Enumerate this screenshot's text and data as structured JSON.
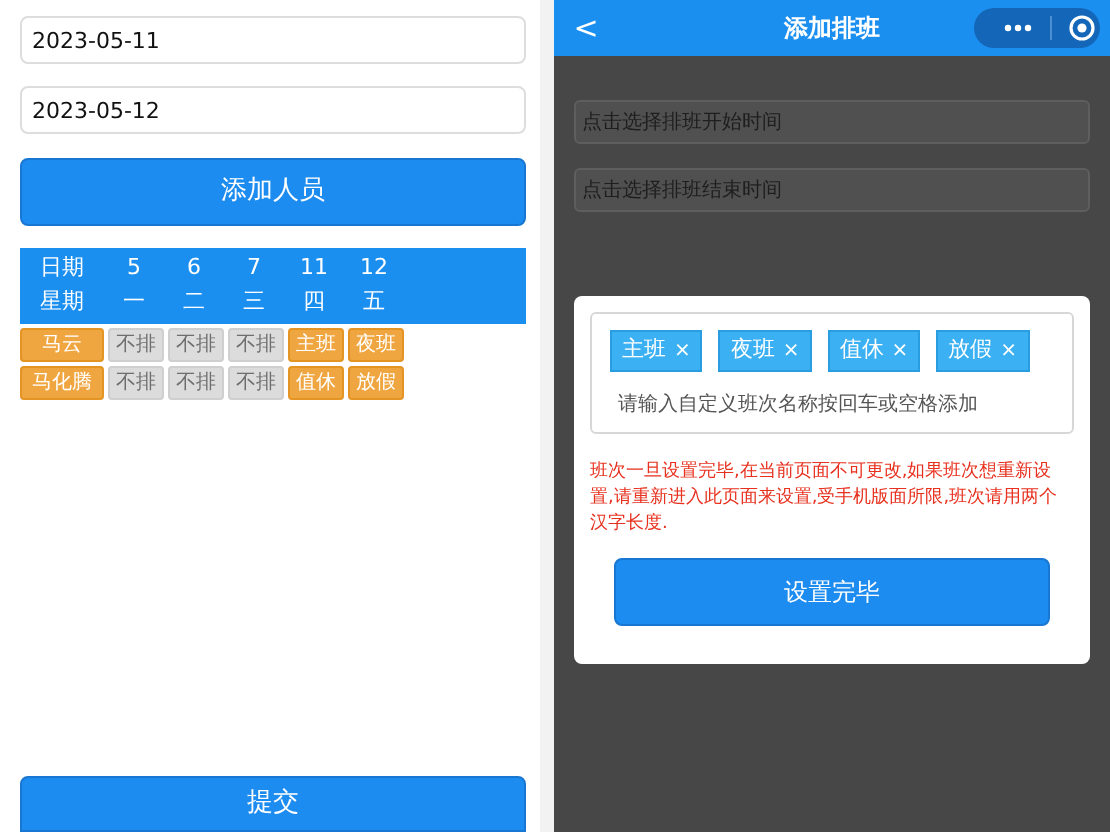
{
  "left_screen": {
    "date_fields": [
      {
        "value": "2023-05-11"
      },
      {
        "value": "2023-05-12"
      }
    ],
    "add_button": "添加人员",
    "schedule": {
      "header_rows": [
        {
          "label": "日期",
          "cells": [
            "5",
            "6",
            "7",
            "11",
            "12"
          ]
        },
        {
          "label": "星期",
          "cells": [
            "一",
            "二",
            "三",
            "四",
            "五"
          ]
        }
      ],
      "people": [
        {
          "name": "马云",
          "cells": [
            {
              "text": "不排",
              "kind": "off"
            },
            {
              "text": "不排",
              "kind": "off"
            },
            {
              "text": "不排",
              "kind": "off"
            },
            {
              "text": "主班",
              "kind": "shift"
            },
            {
              "text": "夜班",
              "kind": "shift"
            }
          ]
        },
        {
          "name": "马化腾",
          "cells": [
            {
              "text": "不排",
              "kind": "off"
            },
            {
              "text": "不排",
              "kind": "off"
            },
            {
              "text": "不排",
              "kind": "off"
            },
            {
              "text": "值休",
              "kind": "shift"
            },
            {
              "text": "放假",
              "kind": "shift"
            }
          ]
        }
      ]
    },
    "submit_button": "提交"
  },
  "right_screen": {
    "title": "添加排班",
    "back": "<",
    "fields": [
      {
        "placeholder": "点击选择排班开始时间"
      },
      {
        "placeholder": "点击选择排班结束时间"
      }
    ],
    "dialog": {
      "tags": [
        {
          "label": "主班",
          "remove": "×"
        },
        {
          "label": "夜班",
          "remove": "×"
        },
        {
          "label": "值休",
          "remove": "×"
        },
        {
          "label": "放假",
          "remove": "×"
        }
      ],
      "input_placeholder": "请输入自定义班次名称按回车或空格添加",
      "warning": "班次一旦设置完毕,在当前页面不可更改,如果班次想重新设置,请重新进入此页面来设置,受手机版面所限,班次请用两个汉字长度.",
      "button": "设置完毕"
    }
  }
}
